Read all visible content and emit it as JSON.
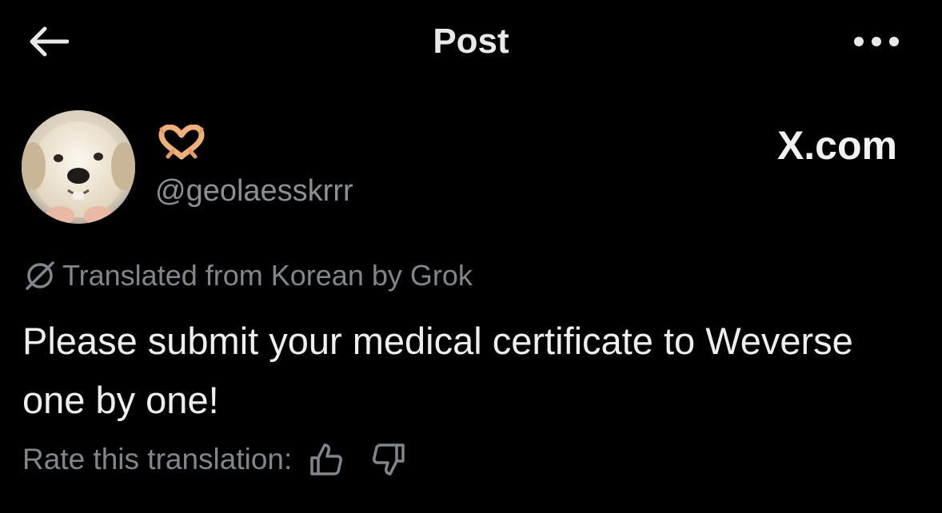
{
  "header": {
    "title": "Post",
    "back_icon": "arrow-left-icon",
    "more_icon": "more-horizontal-icon"
  },
  "author": {
    "display_name_icon": "heart-hands-emoji",
    "handle": "@geolaesskrrr",
    "avatar": "puppy-avatar"
  },
  "watermark": "X.com",
  "translation": {
    "note": "Translated from Korean by Grok",
    "icon": "grok-icon"
  },
  "post": {
    "text": "Please submit your medical certificate to Weverse one by one!"
  },
  "rating": {
    "label": "Rate this translation:",
    "up_icon": "thumbs-up-icon",
    "down_icon": "thumbs-down-icon"
  },
  "colors": {
    "background": "#000000",
    "primary_text": "#e7e9ea",
    "secondary_text": "#80868b"
  }
}
